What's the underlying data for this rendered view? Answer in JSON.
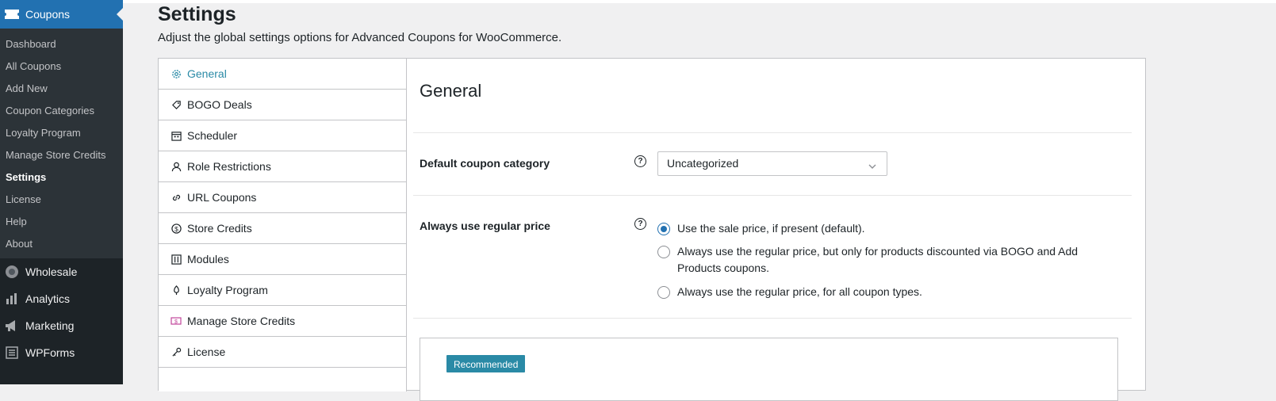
{
  "sidebar": {
    "current_menu": "Coupons",
    "submenu": [
      "Dashboard",
      "All Coupons",
      "Add New",
      "Coupon Categories",
      "Loyalty Program",
      "Manage Store Credits",
      "Settings",
      "License",
      "Help",
      "About"
    ],
    "current_submenu": "Settings",
    "top_items": [
      {
        "label": "Wholesale",
        "icon": "wholesale-icon"
      },
      {
        "label": "Analytics",
        "icon": "analytics-icon"
      },
      {
        "label": "Marketing",
        "icon": "megaphone-icon"
      },
      {
        "label": "WPForms",
        "icon": "wpforms-icon"
      }
    ]
  },
  "page": {
    "title": "Settings",
    "description": "Adjust the global settings options for Advanced Coupons for WooCommerce."
  },
  "tabs": [
    {
      "label": "General",
      "icon": "gear-icon",
      "active": true
    },
    {
      "label": "BOGO Deals",
      "icon": "tag-icon"
    },
    {
      "label": "Scheduler",
      "icon": "calendar-icon"
    },
    {
      "label": "Role Restrictions",
      "icon": "user-icon"
    },
    {
      "label": "URL Coupons",
      "icon": "link-icon"
    },
    {
      "label": "Store Credits",
      "icon": "dollar-icon"
    },
    {
      "label": "Modules",
      "icon": "modules-icon"
    },
    {
      "label": "Loyalty Program",
      "icon": "loyalty-icon"
    },
    {
      "label": "Manage Store Credits",
      "icon": "credit-card-icon"
    },
    {
      "label": "License",
      "icon": "key-icon"
    }
  ],
  "panel": {
    "title": "General",
    "default_category": {
      "label": "Default coupon category",
      "help": "?",
      "value": "Uncategorized"
    },
    "regular_price": {
      "label": "Always use regular price",
      "help": "?",
      "options": [
        {
          "text": "Use the sale price, if present (default).",
          "checked": true
        },
        {
          "text": "Always use the regular price, but only for products discounted via BOGO and Add Products coupons.",
          "checked": false
        },
        {
          "text": "Always use the regular price, for all coupon types.",
          "checked": false
        }
      ]
    },
    "promo_badge": "Recommended"
  },
  "colors": {
    "sidebar_bg": "#1d2327",
    "submenu_bg": "#2c3338",
    "accent": "#2271b1",
    "tab_active": "#2a8aa6",
    "badge": "#2a8aa6"
  }
}
